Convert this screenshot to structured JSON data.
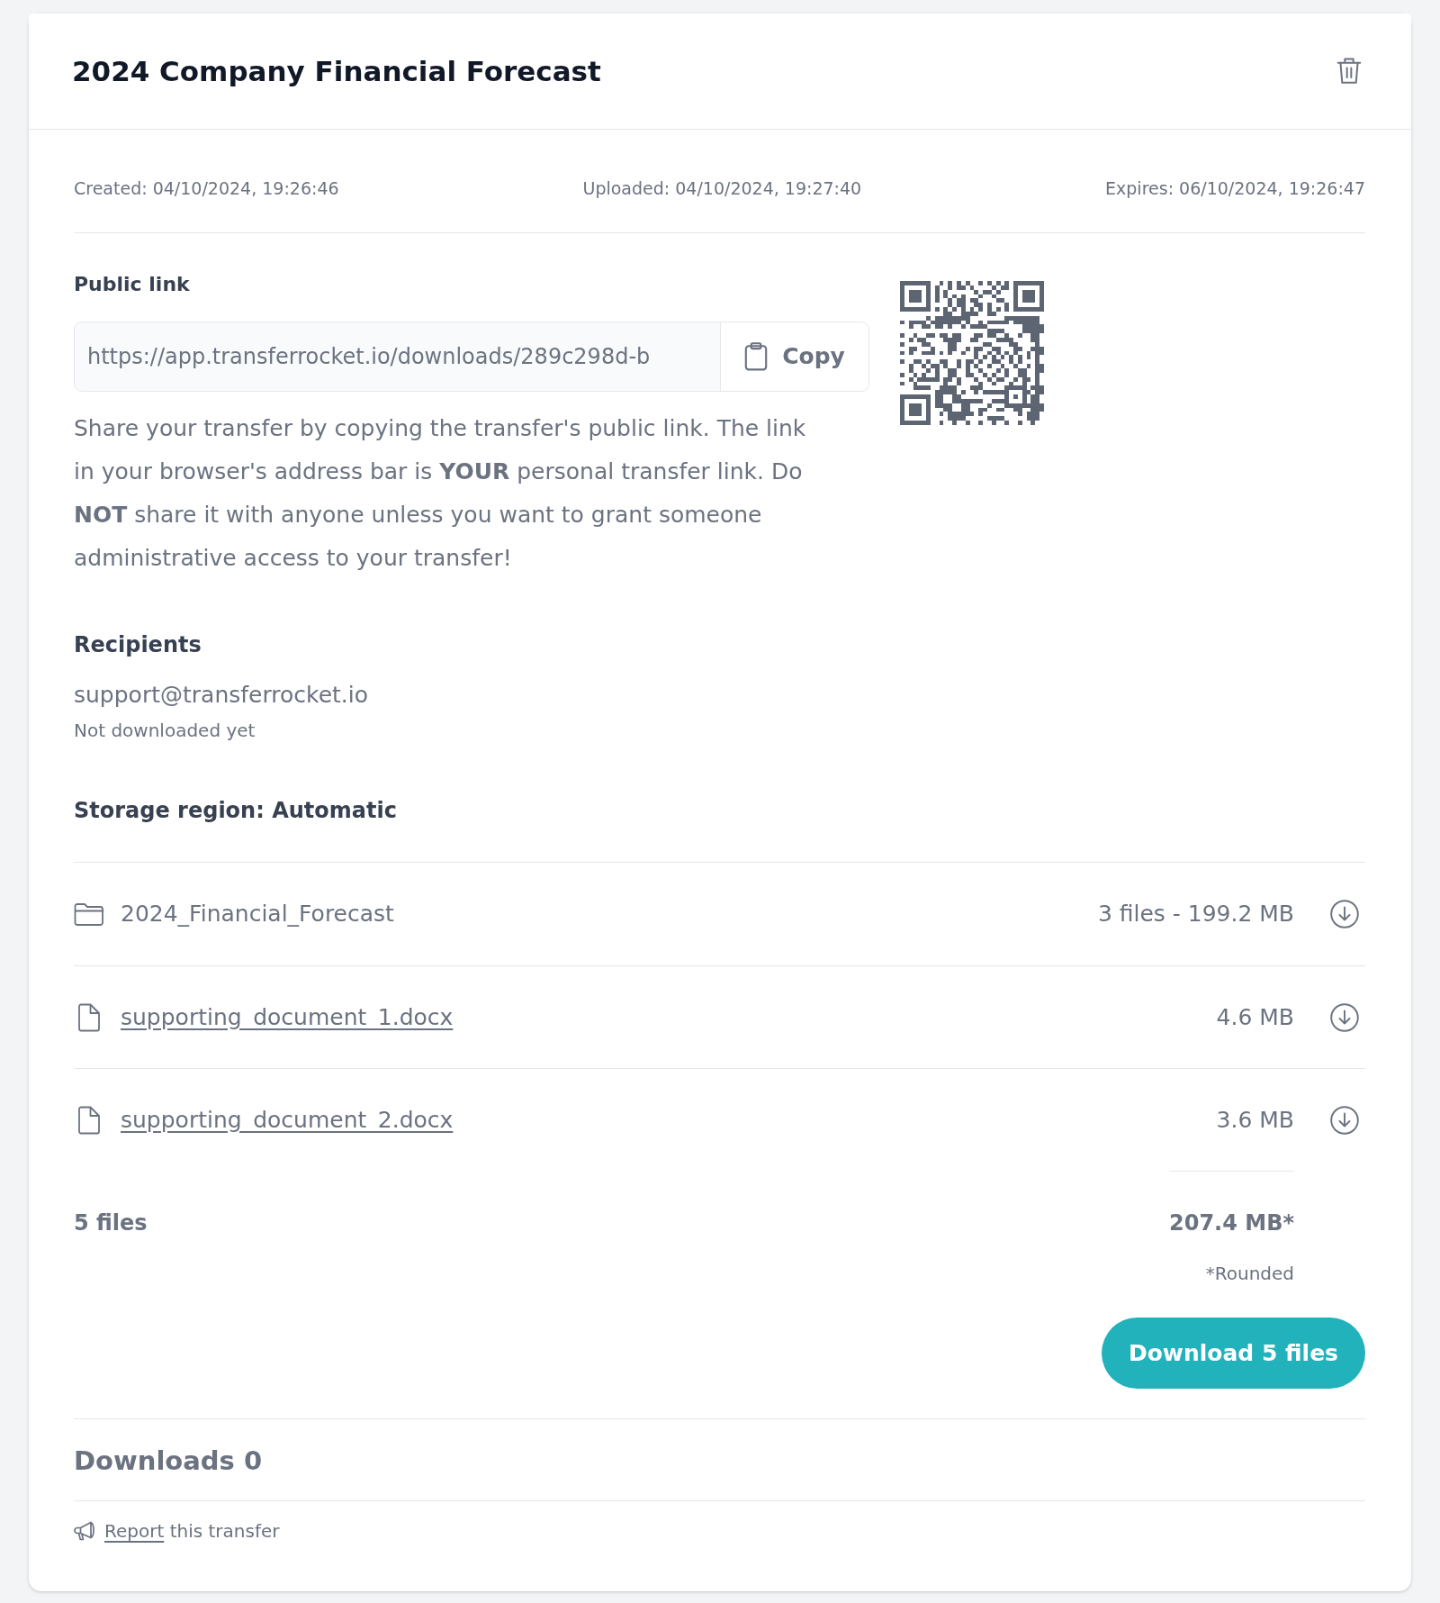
{
  "header": {
    "title": "2024 Company Financial Forecast"
  },
  "meta": [
    "Created: 04/10/2024, 19:26:46",
    "Uploaded: 04/10/2024, 19:27:40",
    "Expires: 06/10/2024, 19:26:47"
  ],
  "public_link": {
    "label": "Public link",
    "url": "https://app.transferrocket.io/downloads/289c298d-b",
    "copy_button": "Copy",
    "note": "Share your transfer by copying the transfer's public link. The link in your browser's address bar is **YOUR** personal transfer link. Do **NOT** share it with anyone unless you want to grant someone administrative access to your transfer!"
  },
  "recipients": {
    "label": "Recipients",
    "items": [
      {
        "email": "support@transferrocket.io",
        "status": "Not downloaded yet"
      }
    ]
  },
  "storage_region": "Storage region: Automatic",
  "files": [
    {
      "kind": "folder",
      "name": "2024_Financial_Forecast",
      "size": "3 files - 199.2 MB"
    },
    {
      "kind": "file",
      "name": "supporting_document_1.docx",
      "size": "4.6 MB"
    },
    {
      "kind": "file",
      "name": "supporting_document_2.docx",
      "size": "3.6 MB"
    }
  ],
  "totals": {
    "count": "5 files",
    "size": "207.4 MB*",
    "note": "*Rounded"
  },
  "download_button": "Download 5 files",
  "downloads": "Downloads 0",
  "report": {
    "link": "Report",
    "text": "this transfer"
  }
}
